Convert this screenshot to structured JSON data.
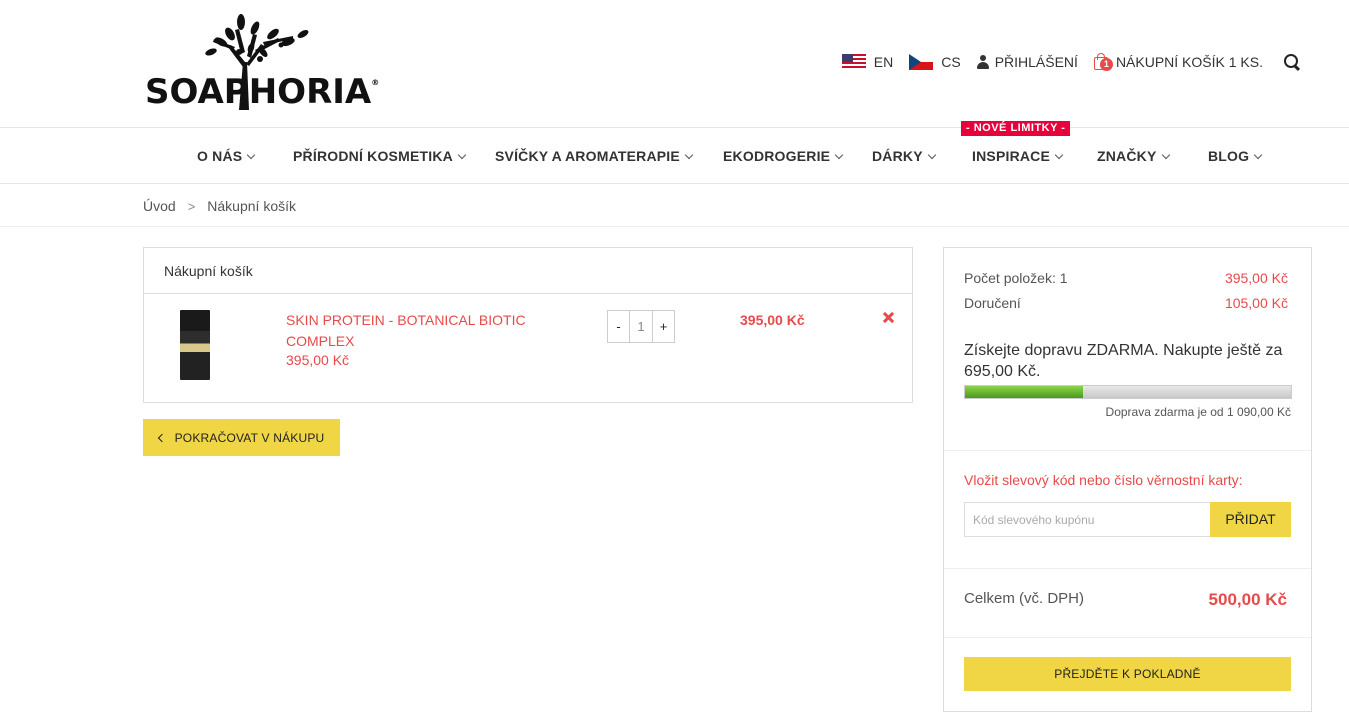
{
  "header": {
    "logo_text": "SOAPHORIA",
    "logo_reg": "®",
    "lang_en": "EN",
    "lang_cs": "CS",
    "login": "PŘIHLÁŠENÍ",
    "cart_badge": "1",
    "cart_label": "NÁKUPNÍ KOŠÍK 1 KS."
  },
  "nav": {
    "items": [
      "O NÁS",
      "PŘÍRODNÍ KOSMETIKA",
      "SVÍČKY A AROMATERAPIE",
      "EKODROGERIE",
      "DÁRKY",
      "INSPIRACE",
      "ZNAČKY",
      "BLOG"
    ],
    "badge": "- NOVÉ LIMITKY -"
  },
  "breadcrumb": {
    "home": "Úvod",
    "sep": ">",
    "current": "Nákupní košík"
  },
  "cart": {
    "title": "Nákupní košík",
    "item": {
      "name": "SKIN PROTEIN - BOTANICAL BIOTIC COMPLEX",
      "unit_price": "395,00 Kč",
      "qty_minus": "-",
      "quantity": "1",
      "qty_plus": "+",
      "total": "395,00 Kč"
    },
    "continue_label": "POKRAČOVAT V NÁKUPU"
  },
  "summary": {
    "items_label": "Počet položek: 1",
    "items_value": "395,00 Kč",
    "delivery_label": "Doručení",
    "delivery_value": "105,00 Kč",
    "free_shipping_text": "Získejte dopravu ZDARMA. Nakupte ještě za 695,00 Kč.",
    "progress_fraction": 0.362,
    "progress_note": "Doprava zdarma je od 1 090,00 Kč",
    "coupon_label": "Vložit slevový kód nebo číslo věrnostní karty:",
    "coupon_placeholder": "Kód slevového kupónu",
    "coupon_button": "PŘIDAT",
    "total_label": "Celkem (vč. DPH)",
    "total_value": "500,00 Kč",
    "checkout_label": "PŘEJDĚTE K POKLADNĚ"
  },
  "colors": {
    "accent_red": "#e84a4a",
    "button_yellow": "#f0d544",
    "badge_red": "#e8003d",
    "progress_green": "#6ab833"
  }
}
